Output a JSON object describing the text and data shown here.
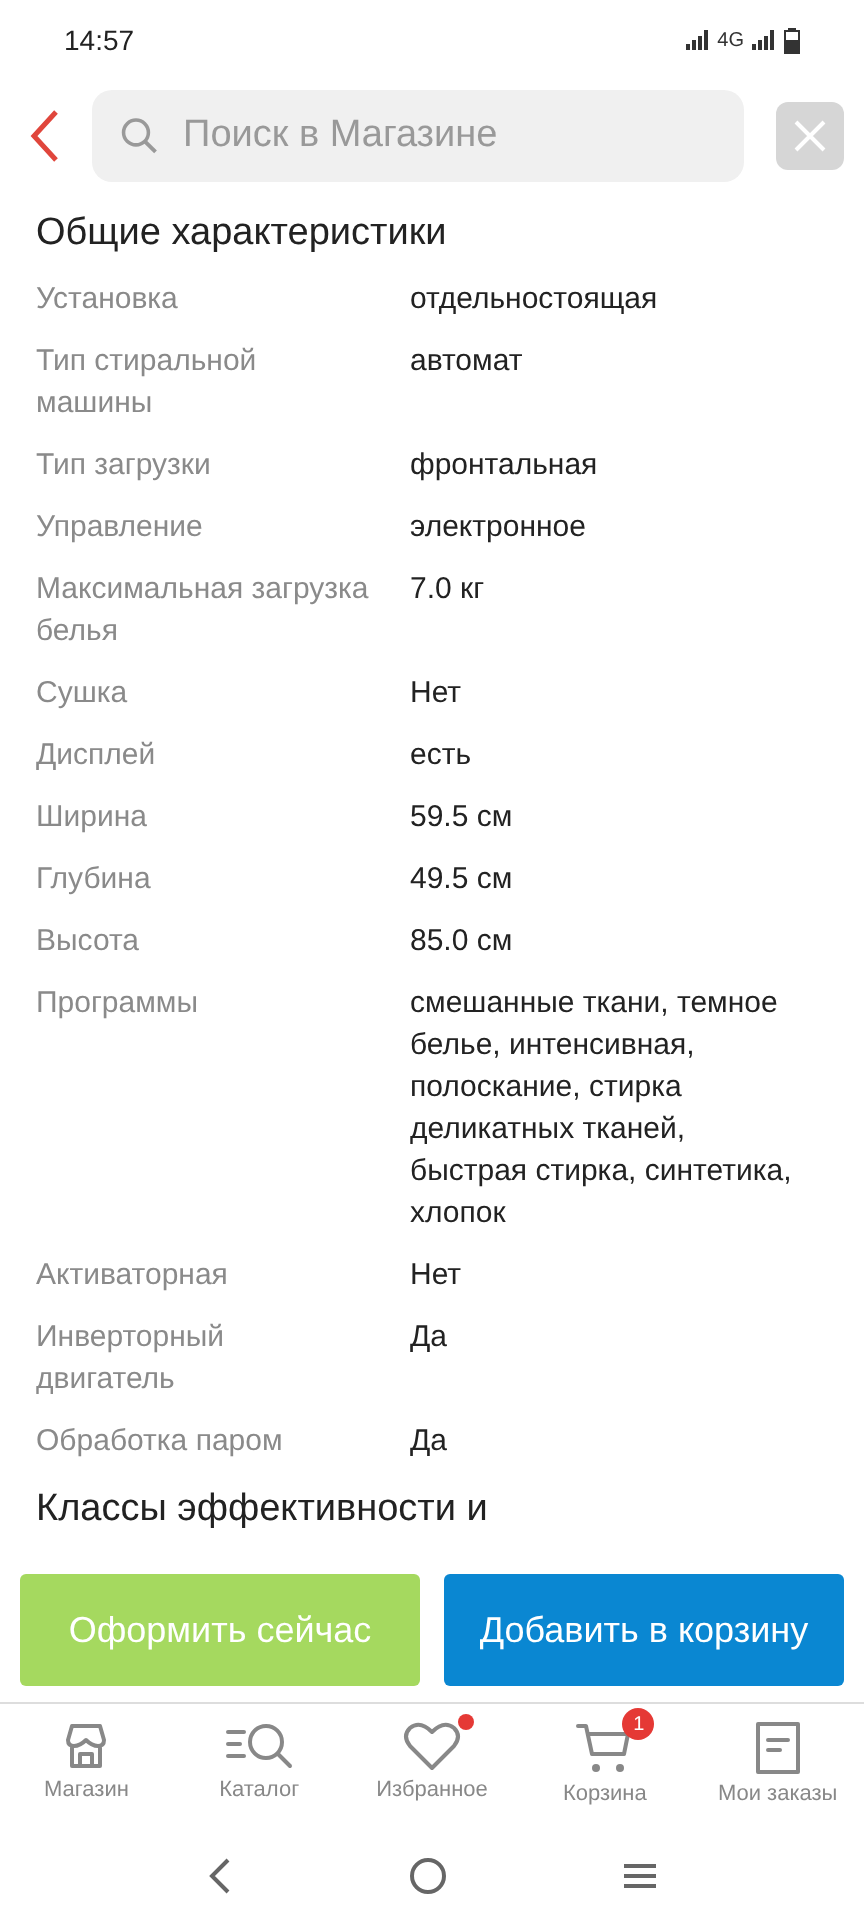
{
  "status_bar": {
    "time": "14:57",
    "network": "4G"
  },
  "header": {
    "search": {
      "placeholder": "Поиск в Магазине"
    }
  },
  "section": {
    "title": "Общие характеристики",
    "rows": [
      {
        "label": "Установка",
        "value": "отдельностоящая"
      },
      {
        "label": "Тип стиральной машины",
        "value": "автомат"
      },
      {
        "label": "Тип загрузки",
        "value": "фронтальная"
      },
      {
        "label": "Управление",
        "value": "электронное"
      },
      {
        "label": "Максимальная загрузка белья",
        "value": "7.0 кг"
      },
      {
        "label": "Сушка",
        "value": "Нет"
      },
      {
        "label": "Дисплей",
        "value": "есть"
      },
      {
        "label": "Ширина",
        "value": "59.5 см"
      },
      {
        "label": "Глубина",
        "value": "49.5 см"
      },
      {
        "label": "Высота",
        "value": "85.0 см"
      },
      {
        "label": "Программы",
        "value": "смешанные ткани, темное белье, интенсивная, полоскание, стирка деликатных тканей, быстрая стирка, синтетика, хлопок"
      },
      {
        "label": "Активаторная",
        "value": "Нет"
      },
      {
        "label": "Инверторный двигатель",
        "value": "Да"
      },
      {
        "label": "Обработка паром",
        "value": "Да"
      }
    ]
  },
  "next_section": {
    "title": "Классы эффективности и"
  },
  "actions": [
    {
      "kind": "primary",
      "label": "Оформить сейчас"
    },
    {
      "kind": "secondary",
      "label": "Добавить в корзину"
    }
  ],
  "bottom_nav": [
    {
      "label": "Магазин",
      "dot": false
    },
    {
      "label": "Каталог",
      "dot": false
    },
    {
      "label": "Избранное",
      "dot": true
    },
    {
      "label": "Корзина",
      "dot": false,
      "count": "1"
    },
    {
      "label": "Мои заказы",
      "dot": false
    }
  ]
}
